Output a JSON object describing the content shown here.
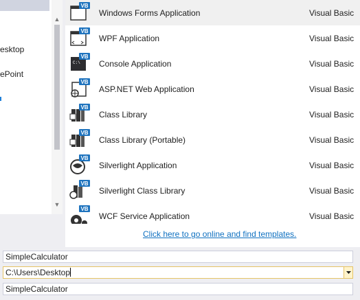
{
  "left_tree": {
    "items": [
      {
        "label": "esktop"
      },
      {
        "label": "ePoint"
      }
    ]
  },
  "templates": [
    {
      "name": "Windows Forms Application",
      "lang": "Visual Basic",
      "icon": "windows-forms-vb-icon",
      "selected": true
    },
    {
      "name": "WPF Application",
      "lang": "Visual Basic",
      "icon": "wpf-vb-icon"
    },
    {
      "name": "Console Application",
      "lang": "Visual Basic",
      "icon": "console-vb-icon"
    },
    {
      "name": "ASP.NET Web Application",
      "lang": "Visual Basic",
      "icon": "aspnet-vb-icon"
    },
    {
      "name": "Class Library",
      "lang": "Visual Basic",
      "icon": "class-library-vb-icon"
    },
    {
      "name": "Class Library (Portable)",
      "lang": "Visual Basic",
      "icon": "class-library-portable-vb-icon"
    },
    {
      "name": "Silverlight Application",
      "lang": "Visual Basic",
      "icon": "silverlight-vb-icon"
    },
    {
      "name": "Silverlight Class Library",
      "lang": "Visual Basic",
      "icon": "silverlight-class-library-vb-icon"
    },
    {
      "name": "WCF Service Application",
      "lang": "Visual Basic",
      "icon": "wcf-vb-icon"
    }
  ],
  "icon_badge_text": "VB",
  "console_icon_text": "C:\\",
  "online_link": "Click here to go online and find templates.",
  "fields": {
    "name_value": "SimpleCalculator",
    "location_value": "C:\\Users\\Desktop",
    "solution_value": "SimpleCalculator"
  },
  "colors": {
    "link": "#0e70c0",
    "vb_badge": "#1e73be",
    "location_border": "#e5c365"
  }
}
